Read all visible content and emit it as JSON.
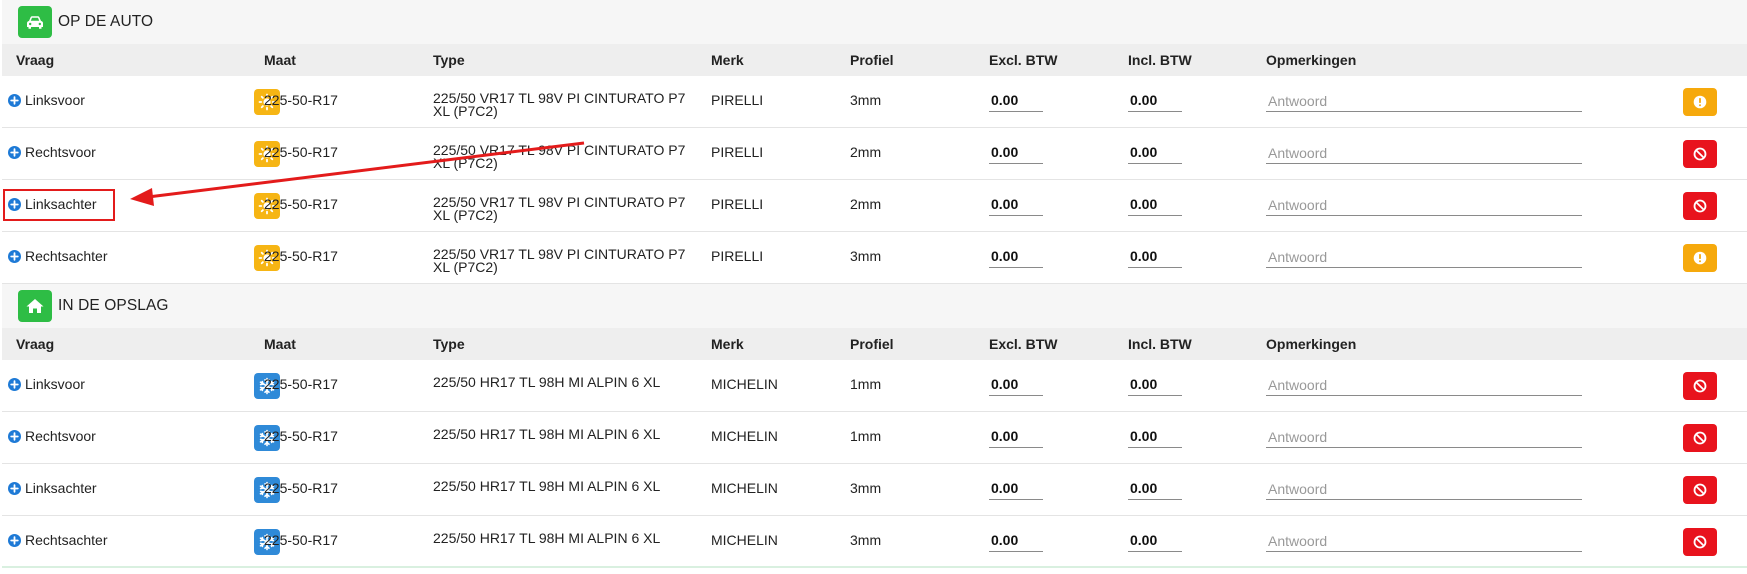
{
  "columns": {
    "vraag": "Vraag",
    "maat": "Maat",
    "type": "Type",
    "merk": "Merk",
    "profiel": "Profiel",
    "excl": "Excl. BTW",
    "incl": "Incl. BTW",
    "opmerkingen": "Opmerkingen"
  },
  "answer_placeholder": "Antwoord",
  "sections": [
    {
      "title": "OP DE AUTO",
      "icon": "car-icon",
      "rows": [
        {
          "vraag": "Linksvoor",
          "season": "summer",
          "maat": "225-50-R17",
          "type": "225/50 VR17 TL 98V PI CINTURATO P7 XL (P7C2)",
          "merk": "PIRELLI",
          "profiel": "3mm",
          "excl": "0.00",
          "incl": "0.00",
          "status": "warn"
        },
        {
          "vraag": "Rechtsvoor",
          "season": "summer",
          "maat": "225-50-R17",
          "type": "225/50 VR17 TL 98V PI CINTURATO P7 XL (P7C2)",
          "merk": "PIRELLI",
          "profiel": "2mm",
          "excl": "0.00",
          "incl": "0.00",
          "status": "block"
        },
        {
          "vraag": "Linksachter",
          "season": "summer",
          "maat": "225-50-R17",
          "type": "225/50 VR17 TL 98V PI CINTURATO P7 XL (P7C2)",
          "merk": "PIRELLI",
          "profiel": "2mm",
          "excl": "0.00",
          "incl": "0.00",
          "status": "block"
        },
        {
          "vraag": "Rechtsachter",
          "season": "summer",
          "maat": "225-50-R17",
          "type": "225/50 VR17 TL 98V PI CINTURATO P7 XL (P7C2)",
          "merk": "PIRELLI",
          "profiel": "3mm",
          "excl": "0.00",
          "incl": "0.00",
          "status": "warn"
        }
      ]
    },
    {
      "title": "IN DE OPSLAG",
      "icon": "home-icon",
      "rows": [
        {
          "vraag": "Linksvoor",
          "season": "winter",
          "maat": "225-50-R17",
          "type": "225/50 HR17 TL 98H MI ALPIN 6 XL",
          "merk": "MICHELIN",
          "profiel": "1mm",
          "excl": "0.00",
          "incl": "0.00",
          "status": "block"
        },
        {
          "vraag": "Rechtsvoor",
          "season": "winter",
          "maat": "225-50-R17",
          "type": "225/50 HR17 TL 98H MI ALPIN 6 XL",
          "merk": "MICHELIN",
          "profiel": "1mm",
          "excl": "0.00",
          "incl": "0.00",
          "status": "block"
        },
        {
          "vraag": "Linksachter",
          "season": "winter",
          "maat": "225-50-R17",
          "type": "225/50 HR17 TL 98H MI ALPIN 6 XL",
          "merk": "MICHELIN",
          "profiel": "3mm",
          "excl": "0.00",
          "incl": "0.00",
          "status": "block"
        },
        {
          "vraag": "Rechtsachter",
          "season": "winter",
          "maat": "225-50-R17",
          "type": "225/50 HR17 TL 98H MI ALPIN 6 XL",
          "merk": "MICHELIN",
          "profiel": "3mm",
          "excl": "0.00",
          "incl": "0.00",
          "status": "block"
        }
      ]
    }
  ],
  "colors": {
    "section_icon": "#2ebd45",
    "summer": "#f6b514",
    "winter": "#2f8ad8",
    "warn": "#f6a90c",
    "block": "#e8131d",
    "annotation": "#e31b1b"
  }
}
